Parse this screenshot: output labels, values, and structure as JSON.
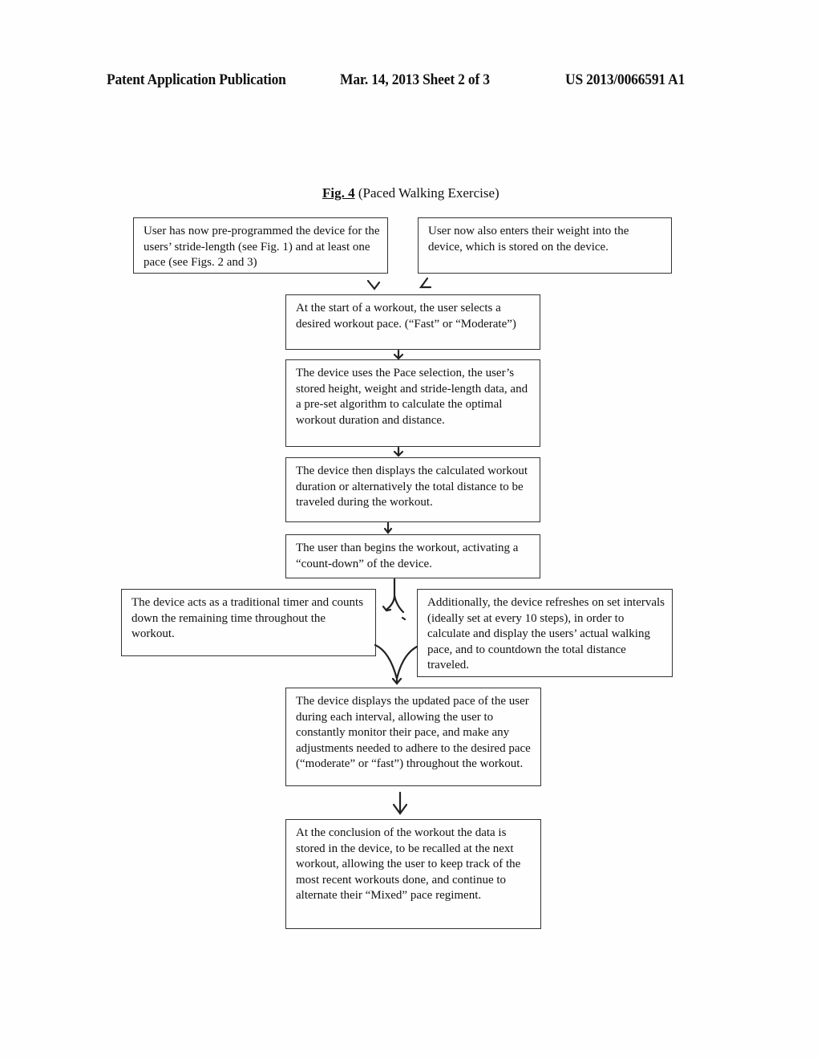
{
  "header": {
    "left": "Patent Application Publication",
    "center": "Mar. 14, 2013  Sheet 2 of 3",
    "right": "US 2013/0066591 A1"
  },
  "figure": {
    "label": "Fig. 4",
    "title": " (Paced Walking Exercise)"
  },
  "flowchart": {
    "boxes": [
      {
        "id": "preprogrammed",
        "text": "User has now  pre-programmed the device for the users’ stride-length (see Fig. 1) and at least one pace (see Figs. 2 and 3)"
      },
      {
        "id": "enter-weight",
        "text": "User now also enters their weight into the device, which is stored on the device."
      },
      {
        "id": "select-pace",
        "text": "At the start of a workout, the user selects a desired workout pace. (“Fast” or “Moderate”)"
      },
      {
        "id": "calculate",
        "text": "The device uses the Pace selection, the user’s stored height, weight and stride-length data, and a pre-set algorithm to calculate the optimal workout duration and distance."
      },
      {
        "id": "display-calculated",
        "text": "The device then displays the calculated workout duration or alternatively the total distance to be traveled during the workout."
      },
      {
        "id": "begin-workout",
        "text": "The user than begins the workout, activating a “count-down” of the device."
      },
      {
        "id": "timer",
        "text": "The device acts as a traditional timer and counts down the remaining time throughout the workout."
      },
      {
        "id": "refresh-intervals",
        "text": "Additionally, the device refreshes on set intervals (ideally set at every 10 steps), in order to calculate and display the users’ actual walking pace, and to countdown the total distance traveled."
      },
      {
        "id": "display-updated-pace",
        "text": "The device displays the updated pace of the user during each interval, allowing the user to constantly monitor their pace, and make any adjustments needed to adhere to the desired pace (“moderate” or “fast”) throughout the workout."
      },
      {
        "id": "store-data",
        "text": "At the conclusion of the workout the data is stored in the device, to be recalled at the next workout, allowing the user to keep track of the most recent workouts done, and continue to alternate their  “Mixed” pace regiment."
      }
    ]
  }
}
